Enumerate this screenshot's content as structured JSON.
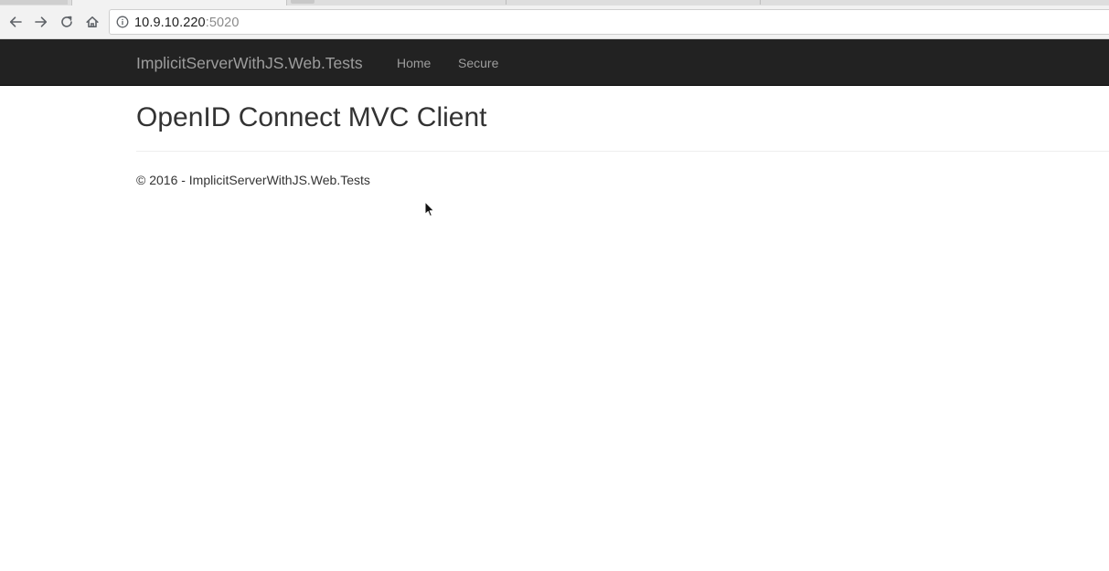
{
  "browser": {
    "url_host": "10.9.10.220",
    "url_port": ":5020",
    "icons": {
      "back": "arrow-left-icon",
      "forward": "arrow-right-icon",
      "reload": "reload-icon",
      "home": "home-icon",
      "site_info": "info-icon"
    }
  },
  "navbar": {
    "brand": "ImplicitServerWithJS.Web.Tests",
    "links": [
      {
        "label": "Home"
      },
      {
        "label": "Secure"
      }
    ],
    "background": "#222222",
    "link_color": "#9d9d9d"
  },
  "main": {
    "title": "OpenID Connect MVC Client"
  },
  "footer": {
    "text": "© 2016 - ImplicitServerWithJS.Web.Tests"
  }
}
